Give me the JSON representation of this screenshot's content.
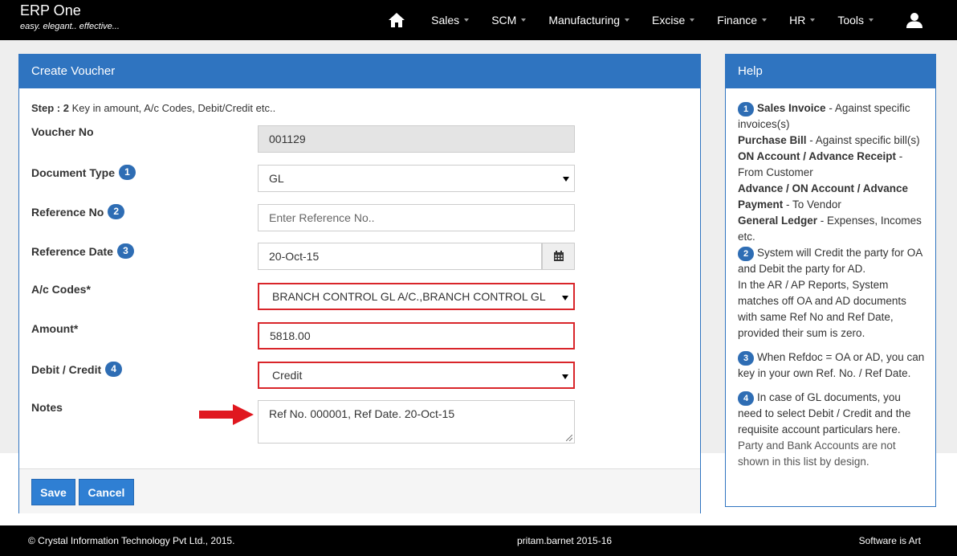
{
  "app": {
    "title": "ERP One",
    "tagline": "easy. elegant.. effective..."
  },
  "nav": {
    "home_icon": "home-icon",
    "items": [
      {
        "label": "Sales"
      },
      {
        "label": "SCM"
      },
      {
        "label": "Manufacturing"
      },
      {
        "label": "Excise"
      },
      {
        "label": "Finance"
      },
      {
        "label": "HR"
      },
      {
        "label": "Tools"
      }
    ],
    "user_icon": "user-icon"
  },
  "voucher": {
    "heading": "Create Voucher",
    "step_label": "Step : 2",
    "step_text": " Key in amount, A/c Codes, Debit/Credit etc..",
    "fields": {
      "voucher_no": {
        "label": "Voucher No",
        "value": "001129"
      },
      "document_type": {
        "label": "Document Type",
        "badge": "1",
        "value": "GL"
      },
      "reference_no": {
        "label": "Reference No",
        "badge": "2",
        "placeholder": "Enter Reference No.."
      },
      "reference_date": {
        "label": "Reference Date",
        "badge": "3",
        "value": "20-Oct-15"
      },
      "ac_codes": {
        "label": "A/c Codes*",
        "value": "BRANCH CONTROL GL A/C.,BRANCH CONTROL GL A/C"
      },
      "amount": {
        "label": "Amount*",
        "value": "5818.00"
      },
      "debit_credit": {
        "label": "Debit / Credit",
        "badge": "4",
        "value": "Credit"
      },
      "notes": {
        "label": "Notes",
        "value": "Ref No. 000001,  Ref Date. 20-Oct-15"
      }
    },
    "buttons": {
      "save": "Save",
      "cancel": "Cancel"
    },
    "error_color": "#d9252a"
  },
  "help": {
    "heading": "Help",
    "b1": "1",
    "sales_invoice": "Sales Invoice",
    "sales_invoice_desc": " - Against specific invoices(s)",
    "purchase_bill": "Purchase Bill",
    "purchase_bill_desc": " - Against specific bill(s)",
    "on_account_receipt": "ON Account / Advance Receipt",
    "on_account_receipt_desc": " - From Customer",
    "advance_payment": "Advance / ON Account / Advance Payment",
    "advance_payment_desc": " - To Vendor",
    "general_ledger": "General Ledger",
    "general_ledger_desc": " - Expenses, Incomes etc.",
    "b2": "2",
    "note2a": "System will Credit the party for OA and Debit the party for AD.",
    "note2b": "In the AR / AP Reports, System matches off OA and AD documents with same Ref No and Ref Date, provided their sum is zero.",
    "b3": "3",
    "note3": "When Refdoc = OA or AD, you can key in your own Ref. No. / Ref Date.",
    "b4": "4",
    "note4": "In case of GL documents, you need to select Debit / Credit and the requisite account particulars here.",
    "note5": "Party and Bank Accounts are not shown in this list by design."
  },
  "footer": {
    "copyright": "© Crystal Information Technology Pvt Ltd., 2015.",
    "user": "pritam.barnet 2015-16",
    "slogan": "Software is Art"
  },
  "colors": {
    "primary": "#2f74c0",
    "navbar": "#000000",
    "badge": "#2e6db4"
  }
}
